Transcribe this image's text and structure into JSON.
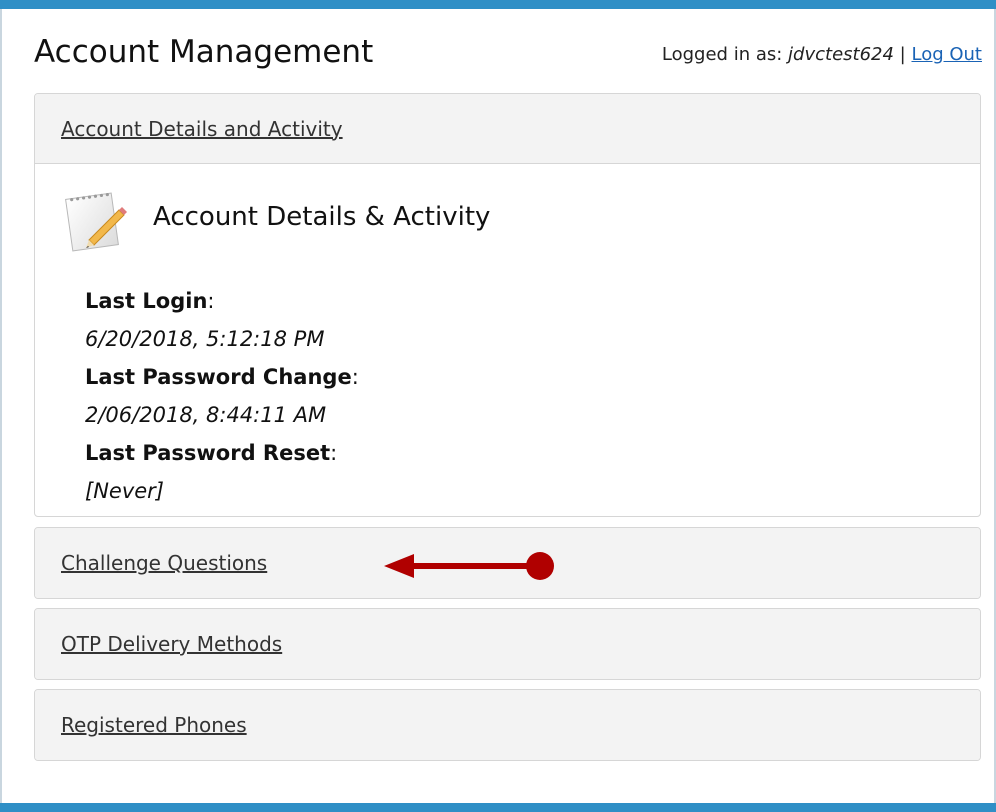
{
  "header": {
    "title": "Account Management",
    "logged_in_prefix": "Logged in as:",
    "username": "jdvctest624",
    "separator": "|",
    "logout_label": "Log Out"
  },
  "panels": [
    {
      "label": "Account Details and Activity",
      "expanded": true,
      "content": {
        "icon": "notepad-pencil-icon",
        "heading": "Account Details & Activity",
        "details": [
          {
            "label": "Last Login",
            "value": "6/20/2018, 5:12:18 PM"
          },
          {
            "label": "Last Password Change",
            "value": "2/06/2018, 8:44:11 AM"
          },
          {
            "label": "Last Password Reset",
            "value": "[Never]"
          }
        ]
      }
    },
    {
      "label": "Challenge Questions",
      "expanded": false
    },
    {
      "label": "OTP Delivery Methods",
      "expanded": false
    },
    {
      "label": "Registered Phones",
      "expanded": false
    }
  ],
  "annotation": {
    "type": "red-arrow-icon",
    "color": "#b00000"
  },
  "colors": {
    "accent_bar": "#2f8fc6",
    "link": "#1a63b5",
    "panel_header_bg": "#f3f3f3"
  }
}
